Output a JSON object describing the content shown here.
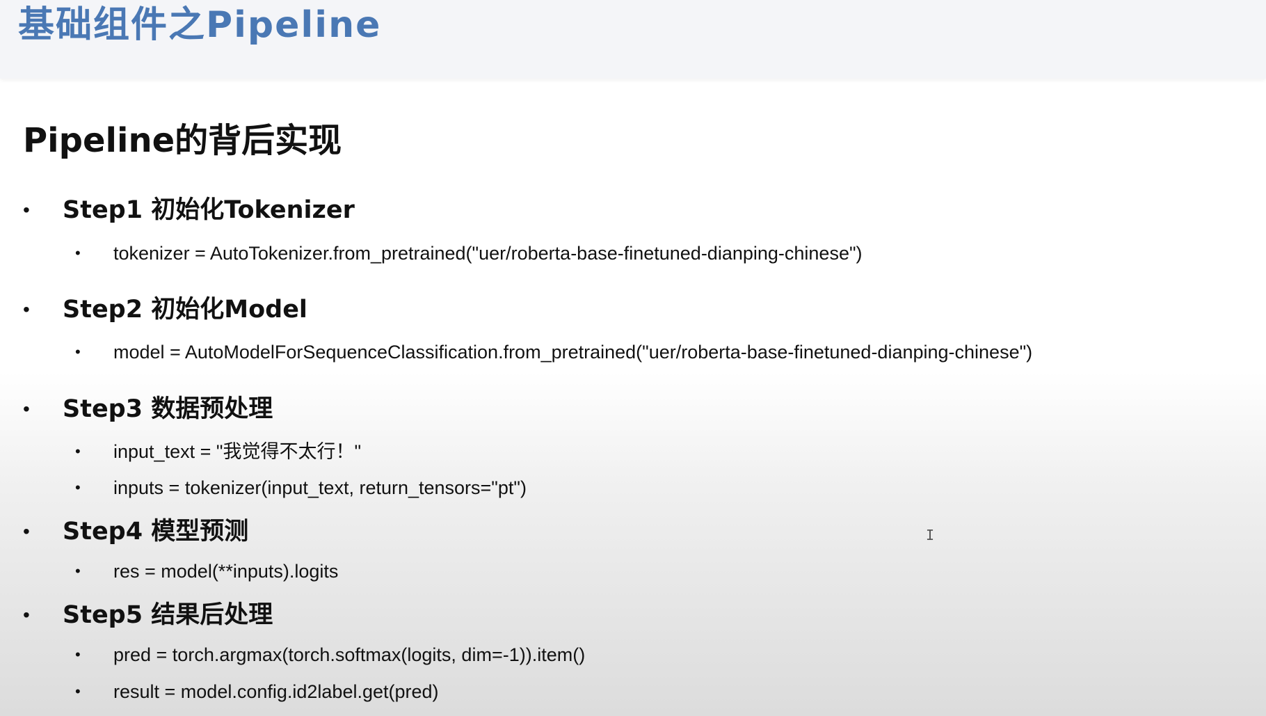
{
  "slide": {
    "title": "基础组件之Pipeline",
    "section_title": "Pipeline的背后实现"
  },
  "steps": [
    {
      "label": "Step1 初始化Tokenizer",
      "lines": [
        "tokenizer = AutoTokenizer.from_pretrained(\"uer/roberta-base-finetuned-dianping-chinese\")"
      ]
    },
    {
      "label": "Step2 初始化Model",
      "lines": [
        "model = AutoModelForSequenceClassification.from_pretrained(\"uer/roberta-base-finetuned-dianping-chinese\")"
      ]
    },
    {
      "label": "Step3 数据预处理",
      "lines": [
        "input_text = \"我觉得不太行！\"",
        "inputs = tokenizer(input_text, return_tensors=\"pt\")"
      ]
    },
    {
      "label": "Step4 模型预测",
      "lines": [
        "res = model(**inputs).logits"
      ]
    },
    {
      "label": "Step5 结果后处理",
      "lines": [
        "pred = torch.argmax(torch.softmax(logits, dim=-1)).item()",
        "result = model.config.id2label.get(pred)"
      ]
    }
  ],
  "bullet_glyph": "•",
  "cursor_glyph": "I",
  "colors": {
    "title": "#4a78b4",
    "text": "#111111",
    "header_band": "#f4f5f8"
  }
}
